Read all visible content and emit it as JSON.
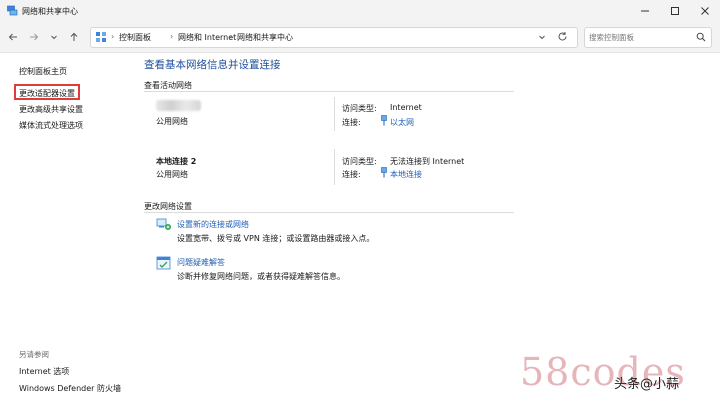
{
  "window": {
    "title": "网络和共享中心"
  },
  "address": {
    "crumbs": [
      "控制面板",
      "网络和 Internet",
      "网络和共享中心"
    ]
  },
  "search": {
    "placeholder": "搜索控制面板"
  },
  "sidebar": {
    "items": [
      {
        "label": "控制面板主页"
      },
      {
        "label": "更改适配器设置",
        "highlighted": true
      },
      {
        "label": "更改高级共享设置"
      },
      {
        "label": "媒体流式处理选项"
      }
    ],
    "see_also": "另请参阅",
    "see_also_items": [
      {
        "label": "Internet 选项"
      },
      {
        "label": "Windows Defender 防火墙"
      }
    ]
  },
  "main": {
    "heading": "查看基本网络信息并设置连接",
    "active_networks_label": "查看活动网络",
    "networks": [
      {
        "name": "",
        "type": "公用网络",
        "access_label": "访问类型:",
        "access_value": "Internet",
        "conn_label": "连接:",
        "conn_value": "以太网"
      },
      {
        "name": "本地连接 2",
        "type": "公用网络",
        "access_label": "访问类型:",
        "access_value": "无法连接到 Internet",
        "conn_label": "连接:",
        "conn_value": "本地连接"
      }
    ],
    "change_settings_label": "更改网络设置",
    "tasks": [
      {
        "title": "设置新的连接或网络",
        "desc": "设置宽带、拨号或 VPN 连接；或设置路由器或接入点。"
      },
      {
        "title": "问题疑难解答",
        "desc": "诊断并修复网络问题，或者获得疑难解答信息。"
      }
    ]
  },
  "overlay": {
    "watermark": "58codes",
    "brand": "头条@小蒜"
  },
  "colors": {
    "link": "#1f5fb5",
    "heading": "#1f4e9a",
    "highlight_box": "#e03a3a"
  }
}
